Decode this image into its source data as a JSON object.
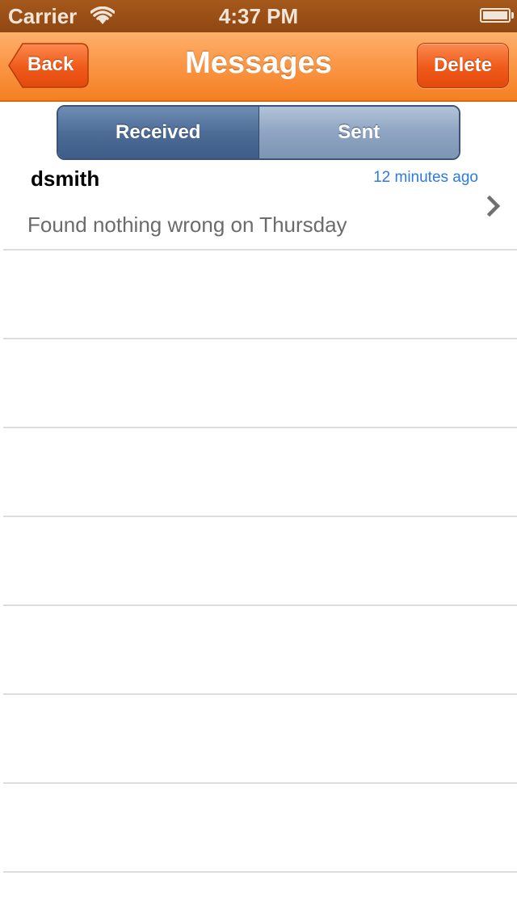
{
  "status_bar": {
    "carrier": "Carrier",
    "time": "4:37 PM",
    "wifi_icon": "wifi-icon",
    "battery_icon": "battery-icon"
  },
  "nav_bar": {
    "title": "Messages",
    "back_label": "Back",
    "delete_label": "Delete",
    "accent_color": "#f4801f"
  },
  "segmented_control": {
    "segments": [
      {
        "label": "Received",
        "selected": true
      },
      {
        "label": "Sent",
        "selected": false
      }
    ]
  },
  "messages": [
    {
      "sender": "dsmith",
      "time": "12 minutes ago",
      "text": "Found nothing wrong on Thursday",
      "icon": "chevron-right-icon"
    }
  ]
}
